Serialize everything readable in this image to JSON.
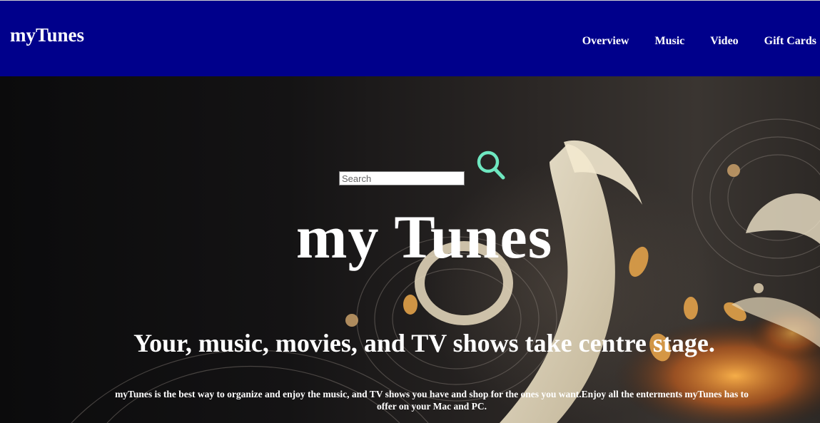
{
  "header": {
    "logo": "myTunes",
    "nav": [
      "Overview",
      "Music",
      "Video",
      "Gift Cards"
    ],
    "background_color": "#00008b"
  },
  "search": {
    "placeholder": "Search",
    "value": "",
    "icon": "search-icon",
    "icon_color": "#6ee7c0"
  },
  "hero": {
    "title": "my Tunes",
    "tagline": "Your, music, movies, and TV shows take centre stage.",
    "description": "myTunes is the best way to organize and enjoy the music, and TV shows you have and shop for the ones you want.Enjoy all the enterments myTunes has to offer on your Mac and PC."
  }
}
